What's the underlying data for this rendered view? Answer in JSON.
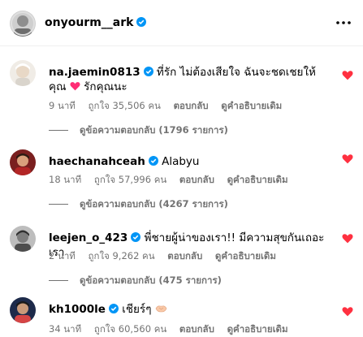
{
  "post": {
    "username": "onyourm__ark",
    "more_icon": "more-horizontal-icon"
  },
  "comments": [
    {
      "username": "na.jaemin0813",
      "text": "ที่รัก ไม่ต้องเสียใจ ฉันจะชดเชยให้คุณ",
      "text_after_emoji": " รักคุณนะ",
      "emoji": "pink-heart",
      "time": "9 นาที",
      "likes": "ถูกใจ 35,506 คน",
      "reply": "ตอบกลับ",
      "see_translation": "ดูคำอธิบายเดิม",
      "view_replies": "ดูข้อความตอบกลับ (1796 รายการ)",
      "liked": true
    },
    {
      "username": "haechanahceah",
      "text": "Alabyu",
      "time": "18 นาที",
      "likes": "ถูกใจ 57,996 คน",
      "reply": "ตอบกลับ",
      "see_translation": "ดูคำอธิบายเดิม",
      "view_replies": "ดูข้อความตอบกลับ (4267 รายการ)",
      "liked": true
    },
    {
      "username": "leejen_o_423",
      "text": "พี่ชายผู้น่าของเรา!! มีความสุขกันเถอะเรา",
      "time": "2 นาที",
      "likes": "ถูกใจ 9,262 คน",
      "reply": "ตอบกลับ",
      "see_translation": "ดูคำอธิบายเดิม",
      "view_replies": "ดูข้อความตอบกลับ (475 รายการ)",
      "liked": true
    },
    {
      "username": "kh1000le",
      "text": "เชียร์ๆ",
      "emoji": "handshake",
      "time": "34 นาที",
      "likes": "ถูกใจ 60,560 คน",
      "reply": "ตอบกลับ",
      "see_translation": "ดูคำอธิบายเดิม",
      "liked": true
    }
  ],
  "colors": {
    "verified": "#0095f6",
    "heart": "#ff3040",
    "meta": "#737373",
    "pink_heart": "#ff2d75"
  }
}
